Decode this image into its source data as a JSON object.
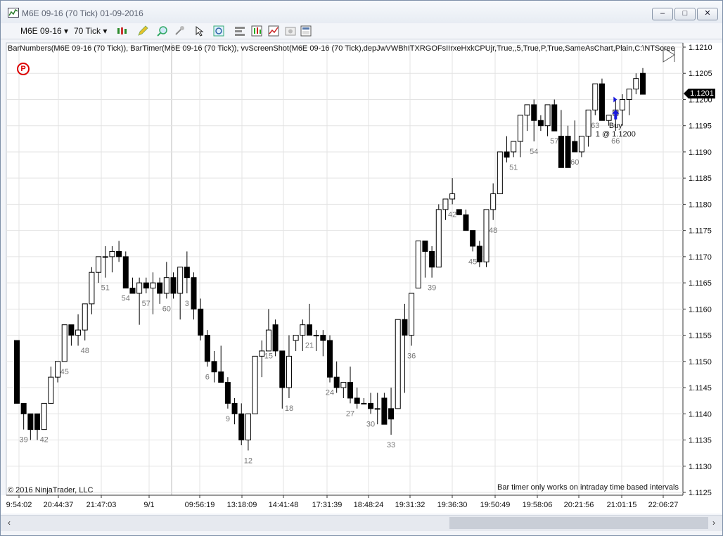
{
  "window": {
    "title": "M6E 09-16 (70 Tick)  01-09-2016",
    "minimize": "–",
    "maximize": "□",
    "close": "✕"
  },
  "toolbar": {
    "instrument": "M6E 09-16",
    "interval": "70 Tick",
    "dropdown_caret": "▾"
  },
  "indicator_line": "BarNumbers(M6E 09-16 (70 Tick)), BarTimer(M6E 09-16 (70 Tick)), vvScreenShot(M6E 09-16 (70 Tick),depJwVWBhITXRGOFsIIrxeHxkCPUjr,True,,5,True,P,True,SameAsChart,Plain,C:\\NTScree",
  "badge": "P",
  "copyright": "© 2016 NinjaTrader, LLC",
  "bar_timer_message": "Bar timer only works on intraday time based intervals",
  "last_price": "1.1201",
  "trade": {
    "side": "Buy",
    "fill": "1 @ 1.1200"
  },
  "scrollbar": {
    "left_arrow": "‹",
    "right_arrow": "›"
  },
  "colors": {
    "up_body": "#ffffff",
    "down_body": "#000000",
    "grid": "#e3e3e3",
    "buy_arrow": "#1a1adc",
    "badge": "#dd0000"
  },
  "chart_data": {
    "type": "candlestick",
    "instrument": "M6E 09-16",
    "interval": "70 Tick",
    "y_ticks": [
      "1.1210",
      "1.1205",
      "1.1200",
      "1.1195",
      "1.1190",
      "1.1185",
      "1.1180",
      "1.1175",
      "1.1170",
      "1.1165",
      "1.1160",
      "1.1155",
      "1.1150",
      "1.1145",
      "1.1140",
      "1.1135",
      "1.1130",
      "1.1125"
    ],
    "x_labels": [
      "9:54:02",
      "20:44:37",
      "21:47:03",
      "9/1",
      "09:56:19",
      "13:18:09",
      "14:41:48",
      "17:31:39",
      "18:48:24",
      "19:31:32",
      "19:36:30",
      "19:50:49",
      "19:58:06",
      "20:21:56",
      "21:01:15",
      "22:06:27"
    ],
    "bar_numbers": [
      "39",
      "42",
      "45",
      "48",
      "51",
      "54",
      "57",
      "60",
      "3",
      "6",
      "9",
      "12",
      "15",
      "18",
      "21",
      "24",
      "27",
      "30",
      "33",
      "36",
      "39",
      "42",
      "45",
      "48",
      "51",
      "54",
      "57",
      "60",
      "63",
      "66"
    ],
    "candles": [
      [
        1.1154,
        1.1154,
        1.1142,
        1.1142
      ],
      [
        1.1142,
        1.1142,
        1.1137,
        1.114
      ],
      [
        1.114,
        1.114,
        1.1135,
        1.1137
      ],
      [
        1.114,
        1.114,
        1.1135,
        1.1137
      ],
      [
        1.1137,
        1.1142,
        1.1137,
        1.1142
      ],
      [
        1.1142,
        1.1149,
        1.1142,
        1.1147
      ],
      [
        1.1147,
        1.115,
        1.1146,
        1.115
      ],
      [
        1.115,
        1.1157,
        1.115,
        1.1157
      ],
      [
        1.1157,
        1.1157,
        1.1153,
        1.1155
      ],
      [
        1.1155,
        1.1159,
        1.1153,
        1.1156
      ],
      [
        1.1156,
        1.1161,
        1.1154,
        1.1161
      ],
      [
        1.1161,
        1.1168,
        1.1159,
        1.1167
      ],
      [
        1.1167,
        1.117,
        1.1165,
        1.117
      ],
      [
        1.117,
        1.1172,
        1.1166,
        1.117
      ],
      [
        1.117,
        1.1172,
        1.1167,
        1.1171
      ],
      [
        1.1171,
        1.1173,
        1.1169,
        1.117
      ],
      [
        1.117,
        1.1171,
        1.1164,
        1.1164
      ],
      [
        1.1164,
        1.1166,
        1.1163,
        1.1163
      ],
      [
        1.1163,
        1.1166,
        1.1157,
        1.1165
      ],
      [
        1.1165,
        1.1166,
        1.1163,
        1.1164
      ],
      [
        1.1164,
        1.1167,
        1.1159,
        1.1165
      ],
      [
        1.1165,
        1.1166,
        1.1161,
        1.1163
      ],
      [
        1.1163,
        1.1169,
        1.1162,
        1.1166
      ],
      [
        1.1166,
        1.1167,
        1.1162,
        1.1163
      ],
      [
        1.1163,
        1.1168,
        1.1158,
        1.1168
      ],
      [
        1.1168,
        1.1171,
        1.1163,
        1.1166
      ],
      [
        1.1166,
        1.1167,
        1.1158,
        1.116
      ],
      [
        1.116,
        1.1162,
        1.1154,
        1.1155
      ],
      [
        1.1155,
        1.1156,
        1.1149,
        1.115
      ],
      [
        1.115,
        1.1152,
        1.1146,
        1.1148
      ],
      [
        1.1148,
        1.1153,
        1.1146,
        1.1146
      ],
      [
        1.1146,
        1.1147,
        1.1141,
        1.1142
      ],
      [
        1.1142,
        1.1143,
        1.1138,
        1.114
      ],
      [
        1.114,
        1.1142,
        1.1134,
        1.1135
      ],
      [
        1.1135,
        1.114,
        1.1133,
        1.114
      ],
      [
        1.114,
        1.1151,
        1.114,
        1.1151
      ],
      [
        1.1151,
        1.1154,
        1.1147,
        1.1152
      ],
      [
        1.1152,
        1.116,
        1.1153,
        1.1156
      ],
      [
        1.1157,
        1.1158,
        1.1151,
        1.1152
      ],
      [
        1.1152,
        1.1152,
        1.1141,
        1.1145
      ],
      [
        1.1145,
        1.1155,
        1.1143,
        1.1151
      ],
      [
        1.1154,
        1.1155,
        1.1152,
        1.1155
      ],
      [
        1.1155,
        1.1158,
        1.1152,
        1.1157
      ],
      [
        1.1157,
        1.1161,
        1.1155,
        1.1155
      ],
      [
        1.1155,
        1.1156,
        1.1152,
        1.1155
      ],
      [
        1.1155,
        1.1156,
        1.1151,
        1.1154
      ],
      [
        1.1154,
        1.1155,
        1.1146,
        1.1147
      ],
      [
        1.1147,
        1.115,
        1.1144,
        1.1145
      ],
      [
        1.1145,
        1.1146,
        1.1143,
        1.1146
      ],
      [
        1.1146,
        1.1149,
        1.1142,
        1.1143
      ],
      [
        1.1143,
        1.1145,
        1.1141,
        1.1142
      ],
      [
        1.1142,
        1.1143,
        1.1142,
        1.1142
      ],
      [
        1.1142,
        1.1144,
        1.114,
        1.1141
      ],
      [
        1.1141,
        1.1144,
        1.1138,
        1.1141
      ],
      [
        1.1143,
        1.1144,
        1.1138,
        1.1138
      ],
      [
        1.1141,
        1.1145,
        1.1136,
        1.1139
      ],
      [
        1.1141,
        1.1158,
        1.1141,
        1.1158
      ],
      [
        1.1158,
        1.1161,
        1.1144,
        1.1155
      ],
      [
        1.1155,
        1.1163,
        1.1153,
        1.1163
      ],
      [
        1.1164,
        1.1173,
        1.1164,
        1.1173
      ],
      [
        1.1173,
        1.1173,
        1.1166,
        1.1171
      ],
      [
        1.1171,
        1.1172,
        1.1166,
        1.1168
      ],
      [
        1.1168,
        1.118,
        1.1168,
        1.1179
      ],
      [
        1.1179,
        1.1181,
        1.1177,
        1.1181
      ],
      [
        1.1181,
        1.1185,
        1.118,
        1.1182
      ],
      [
        1.1179,
        1.1179,
        1.1178,
        1.1178
      ],
      [
        1.1178,
        1.1179,
        1.1175,
        1.1175
      ],
      [
        1.1175,
        1.1175,
        1.1171,
        1.1172
      ],
      [
        1.1172,
        1.1173,
        1.1168,
        1.1169
      ],
      [
        1.1169,
        1.1179,
        1.1168,
        1.1179
      ],
      [
        1.1179,
        1.1184,
        1.1177,
        1.1182
      ],
      [
        1.1182,
        1.119,
        1.1182,
        1.119
      ],
      [
        1.119,
        1.1193,
        1.1188,
        1.1189
      ],
      [
        1.119,
        1.1191,
        1.1189,
        1.1192
      ],
      [
        1.1192,
        1.1194,
        1.1189,
        1.1197
      ],
      [
        1.1197,
        1.1199,
        1.1194,
        1.1199
      ],
      [
        1.1199,
        1.12,
        1.1192,
        1.1196
      ],
      [
        1.1196,
        1.1197,
        1.1194,
        1.1195
      ],
      [
        1.1195,
        1.1198,
        1.1193,
        1.1199
      ],
      [
        1.1199,
        1.12,
        1.1194,
        1.1194
      ],
      [
        1.1193,
        1.1198,
        1.1187,
        1.1187
      ],
      [
        1.1193,
        1.1195,
        1.1187,
        1.1187
      ],
      [
        1.1192,
        1.1196,
        1.119,
        1.119
      ],
      [
        1.119,
        1.1192,
        1.1189,
        1.1193
      ],
      [
        1.1193,
        1.1198,
        1.1191,
        1.1198
      ],
      [
        1.1198,
        1.1203,
        1.1197,
        1.1203
      ],
      [
        1.1203,
        1.1204,
        1.1196,
        1.1196
      ],
      [
        1.1196,
        1.1197,
        1.1195,
        1.1197
      ],
      [
        1.1197,
        1.12,
        1.1194,
        1.1198
      ],
      [
        1.1198,
        1.1201,
        1.1195,
        1.12
      ],
      [
        1.12,
        1.1202,
        1.1197,
        1.1202
      ],
      [
        1.1202,
        1.1205,
        1.1201,
        1.1204
      ],
      [
        1.1205,
        1.1206,
        1.1201,
        1.1201
      ]
    ]
  }
}
